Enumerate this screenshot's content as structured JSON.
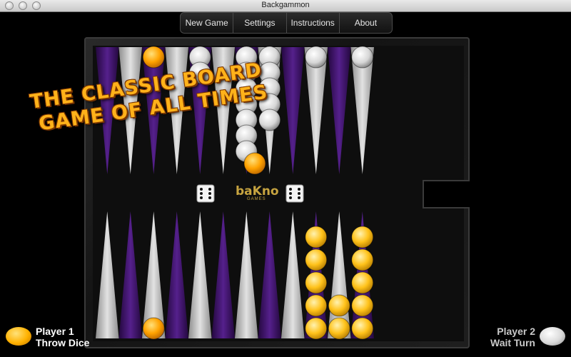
{
  "window": {
    "title": "Backgammon"
  },
  "menu": {
    "new_game": "New Game",
    "settings": "Settings",
    "instructions": "Instructions",
    "about": "About"
  },
  "headline": {
    "line1": "THE CLASSIC BOARD",
    "line2": "GAME OF ALL TIMES"
  },
  "logo": {
    "brand": "baKno",
    "sub": "GAMES"
  },
  "player1": {
    "name": "Player 1",
    "status": "Throw Dice",
    "checker_color": "orange"
  },
  "player2": {
    "name": "Player 2",
    "status": "Wait Turn",
    "checker_color": "white"
  },
  "dice": [
    6,
    6
  ],
  "board": {
    "top_points": [
      {
        "white": 0,
        "orange": 0
      },
      {
        "white": 0,
        "orange": 0
      },
      {
        "white": 0,
        "orange": 1
      },
      {
        "white": 0,
        "orange": 0
      },
      {
        "white": 2,
        "orange": 0
      },
      {
        "white": 0,
        "orange": 0
      },
      {
        "white": 7,
        "orange": 0
      },
      {
        "white": 5,
        "orange": 0
      },
      {
        "white": 0,
        "orange": 0
      },
      {
        "white": 1,
        "orange": 0
      },
      {
        "white": 0,
        "orange": 0
      },
      {
        "white": 1,
        "orange": 0
      }
    ],
    "bottom_points": [
      {
        "white": 0,
        "orange": 0
      },
      {
        "white": 0,
        "orange": 0
      },
      {
        "white": 0,
        "orange": 1
      },
      {
        "white": 0,
        "orange": 0
      },
      {
        "white": 0,
        "orange": 0
      },
      {
        "white": 0,
        "orange": 0
      },
      {
        "white": 0,
        "orange": 0
      },
      {
        "white": 0,
        "orange": 0
      },
      {
        "white": 0,
        "orange": 0
      },
      {
        "white": 0,
        "orange": 5
      },
      {
        "white": 0,
        "orange": 2
      },
      {
        "white": 0,
        "orange": 5
      }
    ],
    "loose_checker": "orange"
  },
  "colors": {
    "purple": "#3d1268",
    "silver": "#c9c9c9",
    "orange": "#ffa200",
    "accent": "#ffb21a"
  }
}
